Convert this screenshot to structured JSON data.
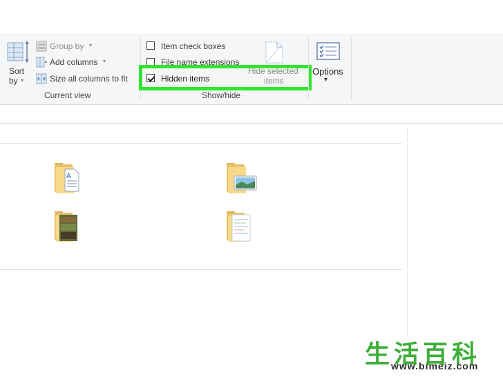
{
  "ribbon": {
    "current_view": {
      "sort_label": "Sort",
      "sort_by_label": "by",
      "group_by_label": "Group by",
      "add_columns_label": "Add columns",
      "size_columns_label": "Size all columns to fit",
      "group_label": "Current view"
    },
    "show_hide": {
      "item_check_boxes_label": "Item check boxes",
      "item_check_boxes_checked": false,
      "file_name_extensions_label": "File name extensions",
      "file_name_extensions_checked": false,
      "hidden_items_label": "Hidden items",
      "hidden_items_checked": true,
      "hide_selected_line1": "Hide selected",
      "hide_selected_line2": "items",
      "group_label": "Show/hide"
    },
    "options_label": "Options"
  },
  "icons": {
    "sort": "sort-columns-icon",
    "group_by": "group-by-icon",
    "add_columns": "add-columns-icon",
    "size_columns": "size-columns-icon",
    "hide_selected": "hide-page-icon",
    "options": "options-checklist-icon",
    "folders": [
      "folder-document-icon",
      "folder-picture-icon",
      "folder-video-icon",
      "folder-files-icon"
    ]
  },
  "colors": {
    "highlight": "#2ee62e",
    "ribbon_bg": "#f5f6f7",
    "folder": "#f6d98a",
    "watermark_green": "#3fae3a"
  },
  "watermark": {
    "chars": "生活百科",
    "url": "www.bimeiz.com"
  }
}
